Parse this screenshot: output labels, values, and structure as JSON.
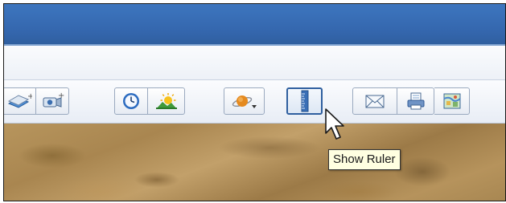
{
  "window": {
    "colors": {
      "titlebar": "#3466ad",
      "toolbar": "#eef2f8",
      "tooltip_bg": "#ffffe1"
    }
  },
  "toolbar": {
    "buttons": [
      {
        "name": "add-placemark-button",
        "icon": "layer-plus-icon"
      },
      {
        "name": "add-tour-button",
        "icon": "camera-plus-icon"
      },
      {
        "name": "historical-imagery-button",
        "icon": "clock-icon"
      },
      {
        "name": "sunlight-button",
        "icon": "sunrise-icon"
      },
      {
        "name": "switch-planet-button",
        "icon": "planet-icon"
      },
      {
        "name": "show-ruler-button",
        "icon": "ruler-icon",
        "active": true
      },
      {
        "name": "email-button",
        "icon": "envelope-icon"
      },
      {
        "name": "print-button",
        "icon": "printer-icon"
      },
      {
        "name": "view-in-maps-button",
        "icon": "map-icon"
      }
    ]
  },
  "tooltip": {
    "text": "Show Ruler"
  },
  "cursor": {
    "icon": "arrow-cursor-icon"
  }
}
